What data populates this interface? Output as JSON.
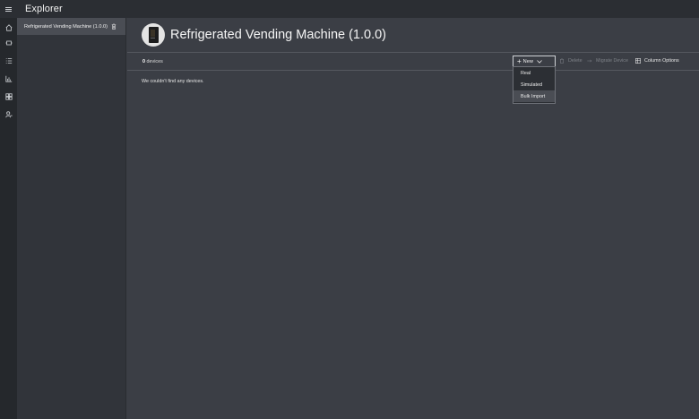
{
  "app": {
    "title": "Explorer"
  },
  "rail": {
    "icons": [
      "home-icon",
      "devices-icon",
      "list-icon",
      "analytics-icon",
      "dashboard-icon",
      "admin-icon"
    ]
  },
  "tree": {
    "items": [
      {
        "label": "Refrigerated Vending Machine (1.0.0)",
        "icon": "trash-icon"
      }
    ]
  },
  "main": {
    "title": "Refrigerated Vending Machine (1.0.0)",
    "device_count": "0",
    "device_count_label": "devices",
    "empty_message": "We couldn't find any devices."
  },
  "toolbar": {
    "new_label": "New",
    "delete_label": "Delete",
    "migrate_label": "Migrate Device",
    "column_options_label": "Column Options"
  },
  "new_menu": {
    "items": [
      {
        "label": "Real"
      },
      {
        "label": "Simulated"
      },
      {
        "label": "Bulk Import"
      }
    ],
    "highlighted_index": 2
  },
  "colors": {
    "background": "#3b3e45",
    "topbar": "#2b2e33",
    "rail": "#25282c",
    "tree_selected": "#4a4d54"
  }
}
